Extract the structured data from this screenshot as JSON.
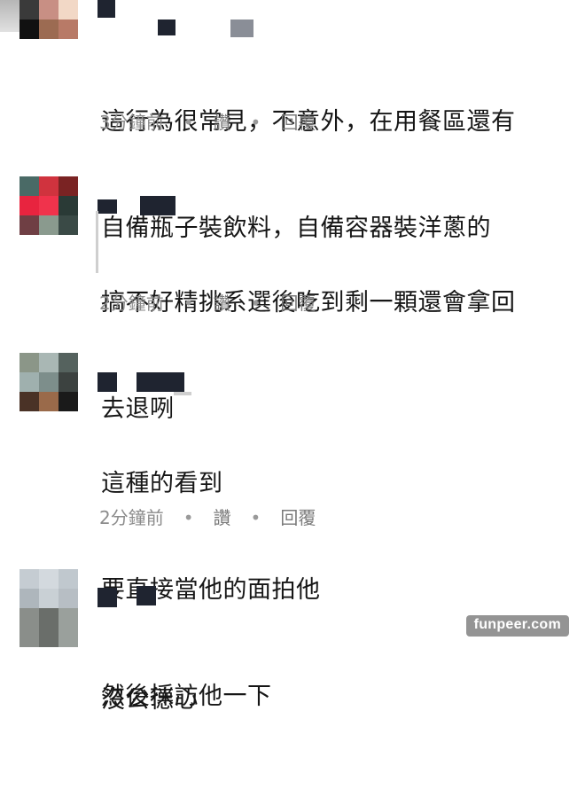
{
  "comments": [
    {
      "text_lines": [
        "這行為很常見，不意外，在用餐區還有",
        "自備瓶子裝飲料，自備容器裝洋蔥的"
      ],
      "time": "3分鐘前",
      "like_label": "讚",
      "reply_label": "回覆",
      "avatar_colors": [
        "#3a3a3a",
        "#c88f84",
        "#f2d8c6",
        "#111111",
        "#9c6b52",
        "#b87a67",
        "#555555",
        "#cfb1a3",
        "#e8d2c4"
      ]
    },
    {
      "text_lines": [
        "搞不好精挑系選後吃到剩一顆還會拿回",
        "去退咧"
      ],
      "time": "2分鐘前",
      "like_label": "讚",
      "reply_label": "回覆",
      "avatar_colors": [
        "#4a6a66",
        "#d0333e",
        "#7a2323",
        "#e8243f",
        "#f0334c",
        "#2a3a36",
        "#6f3f44",
        "#8a9a8e",
        "#3a4a46"
      ]
    },
    {
      "text_lines": [
        "這種的看到",
        "要直接當他的面拍他",
        "然後採訪他一下"
      ],
      "time": "2分鐘前",
      "like_label": "讚",
      "reply_label": "回覆",
      "avatar_colors": [
        "#8b9688",
        "#a9b7b4",
        "#55625e",
        "#9fb0ae",
        "#7d8e8b",
        "#3c4240",
        "#4a3226",
        "#9a6a4a",
        "#1a1a1a"
      ]
    },
    {
      "text_lines": [
        "沒公德心"
      ],
      "avatar_colors": [
        "#c5ccd2",
        "#d3d9de",
        "#c0c8ce",
        "#aeb6bc",
        "#c9d0d5",
        "#b7bec4",
        "#8a8e8a",
        "#6a6e6a",
        "#9aa09c"
      ]
    }
  ],
  "separator": "•",
  "watermark": "funpeer.com"
}
